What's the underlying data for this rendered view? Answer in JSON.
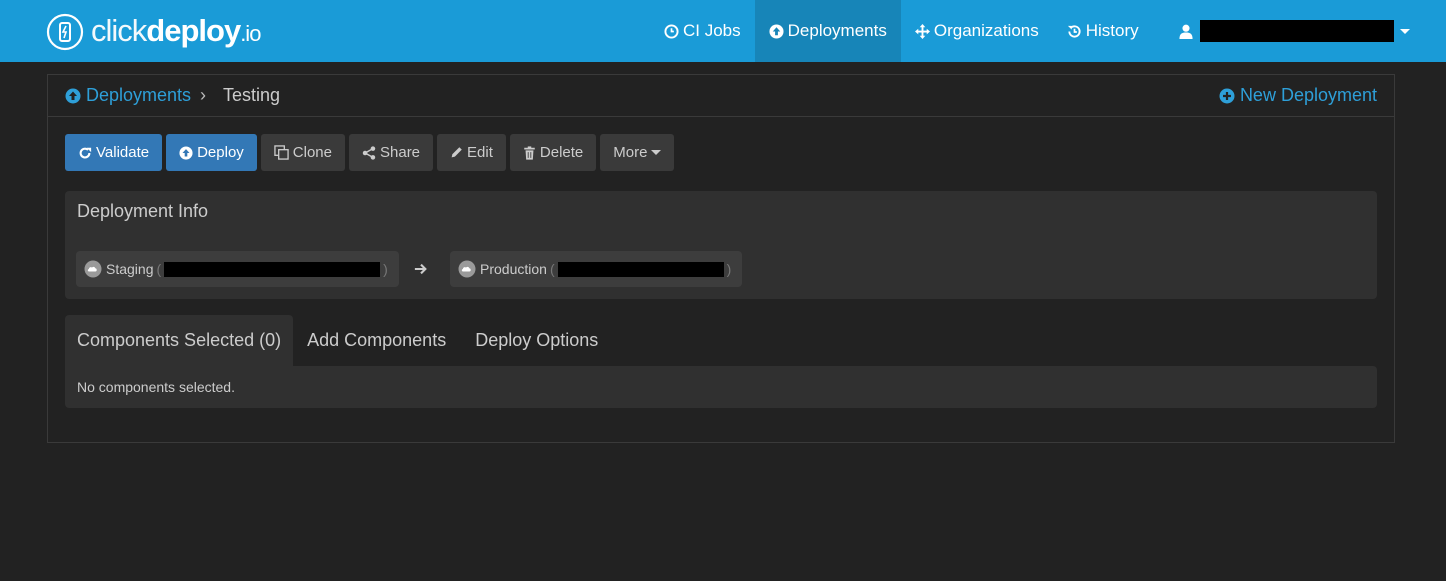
{
  "brand": {
    "light": "click",
    "bold": "deploy",
    "tld": ".io"
  },
  "nav": {
    "items": [
      {
        "label": "CI Jobs",
        "icon": "clock-icon"
      },
      {
        "label": "Deployments",
        "icon": "circle-arrow-up-icon",
        "active": true
      },
      {
        "label": "Organizations",
        "icon": "move-arrows-icon"
      },
      {
        "label": "History",
        "icon": "history-icon"
      }
    ],
    "user_icon": "user-icon"
  },
  "breadcrumb": {
    "parent": "Deployments",
    "separator": "›",
    "current": "Testing"
  },
  "new_deployment_label": "New Deployment",
  "toolbar": {
    "validate": "Validate",
    "deploy": "Deploy",
    "clone": "Clone",
    "share": "Share",
    "edit": "Edit",
    "delete": "Delete",
    "more": "More"
  },
  "deployment_info": {
    "title": "Deployment Info",
    "source": {
      "label": "Staging",
      "open_paren": "(",
      "close_paren": ")"
    },
    "target": {
      "label": "Production",
      "open_paren": "(",
      "close_paren": ")"
    }
  },
  "tabs": [
    {
      "label": "Components Selected (0)",
      "active": true
    },
    {
      "label": "Add Components"
    },
    {
      "label": "Deploy Options"
    }
  ],
  "tab_content": {
    "empty_message": "No components selected."
  },
  "colors": {
    "navbar": "#1a9bd7",
    "navbar_active": "#1785b8",
    "background": "#222222",
    "primary_button": "#3378b6",
    "link": "#2e9fd8"
  }
}
